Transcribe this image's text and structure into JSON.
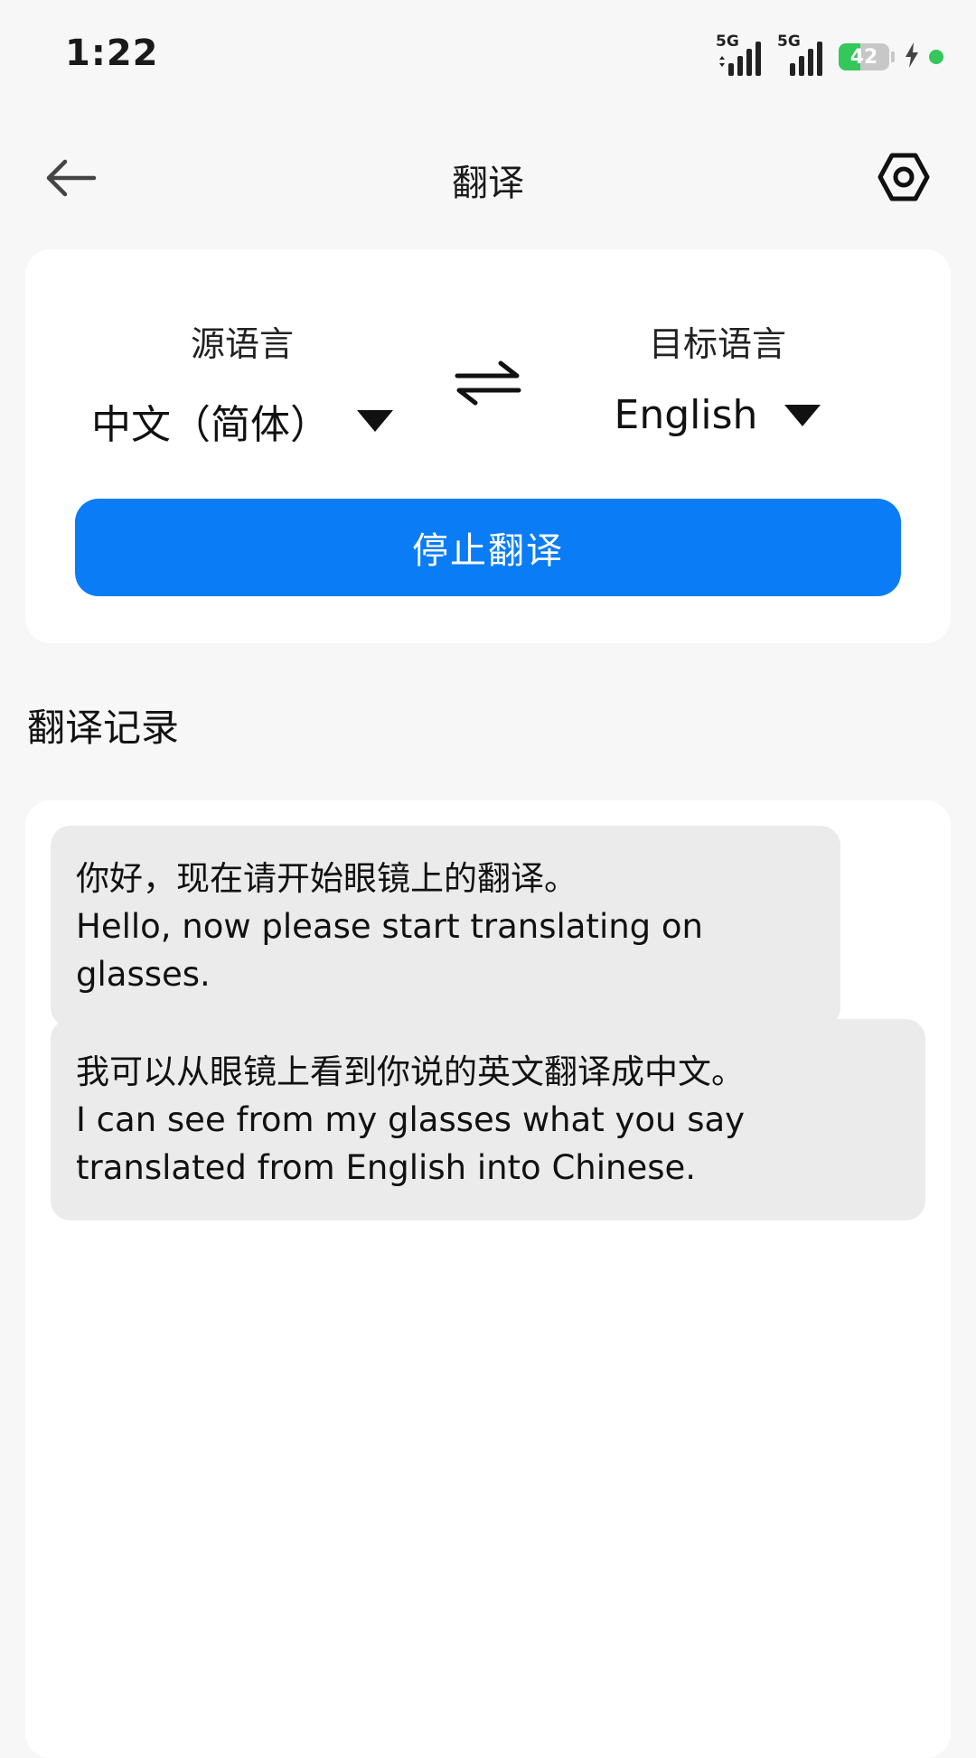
{
  "status_bar": {
    "time": "1:22",
    "signal_1_label": "5G",
    "signal_2_label": "5G",
    "battery_level": "42",
    "battery_fraction": 0.42,
    "colors": {
      "battery_fill": "#34c759",
      "active_dot": "#34c759"
    },
    "icons": [
      "signal-icon",
      "signal-icon",
      "battery-icon",
      "charging-icon",
      "privacy-dot-icon"
    ]
  },
  "header": {
    "title": "翻译",
    "back_icon": "arrow-left-icon",
    "settings_icon": "hexagon-settings-icon"
  },
  "language_card": {
    "source_caption": "源语言",
    "source_value": "中文（简体）",
    "target_caption": "目标语言",
    "target_value": "English",
    "swap_icon": "swap-arrows-icon",
    "dropdown_icon": "triangle-down-icon",
    "action_label": "停止翻译",
    "accent_color": "#0a7cf6"
  },
  "history": {
    "section_title": "翻译记录",
    "records": [
      {
        "source": "你好，现在请开始眼镜上的翻译。",
        "translation": "Hello, now please start translating on glasses."
      },
      {
        "source": "我可以从眼镜上看到你说的英文翻译成中文。",
        "translation": "I can see from my glasses what you say translated from English into Chinese."
      }
    ]
  }
}
